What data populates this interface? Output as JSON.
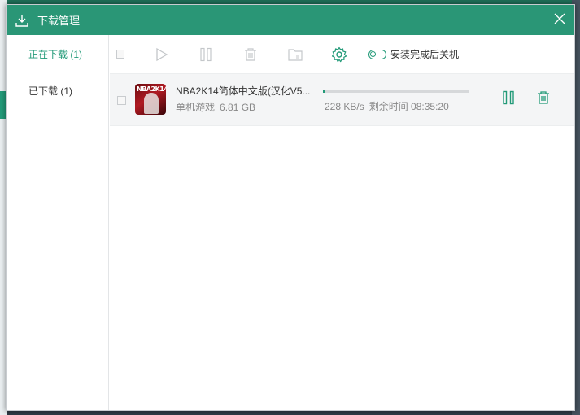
{
  "dialog": {
    "title": "下载管理"
  },
  "sidebar": {
    "items": [
      {
        "label": "正在下载 (1)",
        "active": true
      },
      {
        "label": "已下载 (1)",
        "active": false
      }
    ]
  },
  "toolbar": {
    "icons": [
      "checkbox-icon",
      "play-icon",
      "pause-icon",
      "delete-icon",
      "folder-icon",
      "gear-icon"
    ],
    "shutdown_label": "安装完成后关机"
  },
  "downloads": [
    {
      "name": "NBA2K14简体中文版(汉化V5...",
      "thumb_text": "NBA2K14",
      "category": "单机游戏",
      "size": "6.81 GB",
      "speed": "228 KB/s",
      "remaining": "剩余时间 08:35:20",
      "progress": 0.01
    }
  ],
  "colors": {
    "accent": "#229a78",
    "titlebar": "#2a9676",
    "icon_gray": "#c4c7ca"
  }
}
